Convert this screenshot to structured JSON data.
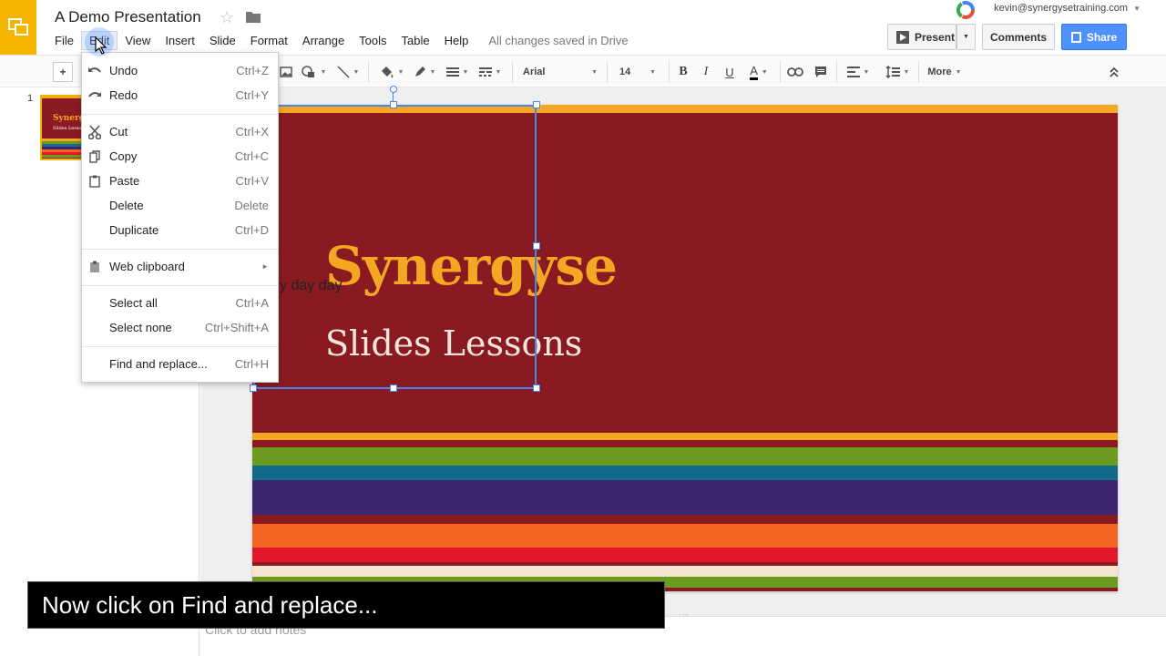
{
  "header": {
    "doc_title": "A Demo Presentation",
    "save_status": "All changes saved in Drive",
    "account_email": "kevin@synergysetraining.com",
    "present_label": "Present",
    "comments_label": "Comments",
    "share_label": "Share"
  },
  "menubar": {
    "items": [
      "File",
      "Edit",
      "View",
      "Insert",
      "Slide",
      "Format",
      "Arrange",
      "Tools",
      "Table",
      "Help"
    ]
  },
  "toolbar": {
    "font_family": "Arial",
    "font_size": "14",
    "more_label": "More",
    "add_label": "+"
  },
  "filmstrip": {
    "slide_number": "1",
    "thumb_title": "Synergyse",
    "thumb_subtitle": "Slides Lessons"
  },
  "slide": {
    "title": "Synergyse",
    "subtitle": "Slides Lessons",
    "stray_text": "y day day"
  },
  "notes": {
    "placeholder": "Click to add notes"
  },
  "edit_menu": {
    "undo": {
      "label": "Undo",
      "shortcut": "Ctrl+Z"
    },
    "redo": {
      "label": "Redo",
      "shortcut": "Ctrl+Y"
    },
    "cut": {
      "label": "Cut",
      "shortcut": "Ctrl+X"
    },
    "copy": {
      "label": "Copy",
      "shortcut": "Ctrl+C"
    },
    "paste": {
      "label": "Paste",
      "shortcut": "Ctrl+V"
    },
    "delete": {
      "label": "Delete",
      "shortcut": "Delete"
    },
    "duplicate": {
      "label": "Duplicate",
      "shortcut": "Ctrl+D"
    },
    "web_clipboard": {
      "label": "Web clipboard",
      "shortcut": "►"
    },
    "select_all": {
      "label": "Select all",
      "shortcut": "Ctrl+A"
    },
    "select_none": {
      "label": "Select none",
      "shortcut": "Ctrl+Shift+A"
    },
    "find_replace": {
      "label": "Find and replace...",
      "shortcut": "Ctrl+H"
    }
  },
  "caption": {
    "text": "Now click on Find and replace..."
  },
  "colors": {
    "slide_background": "#8a1a21",
    "title_color": "#f5a623",
    "selection_blue": "#4a86e8",
    "share_blue": "#4d90fe",
    "logo_yellow": "#f4b400"
  }
}
